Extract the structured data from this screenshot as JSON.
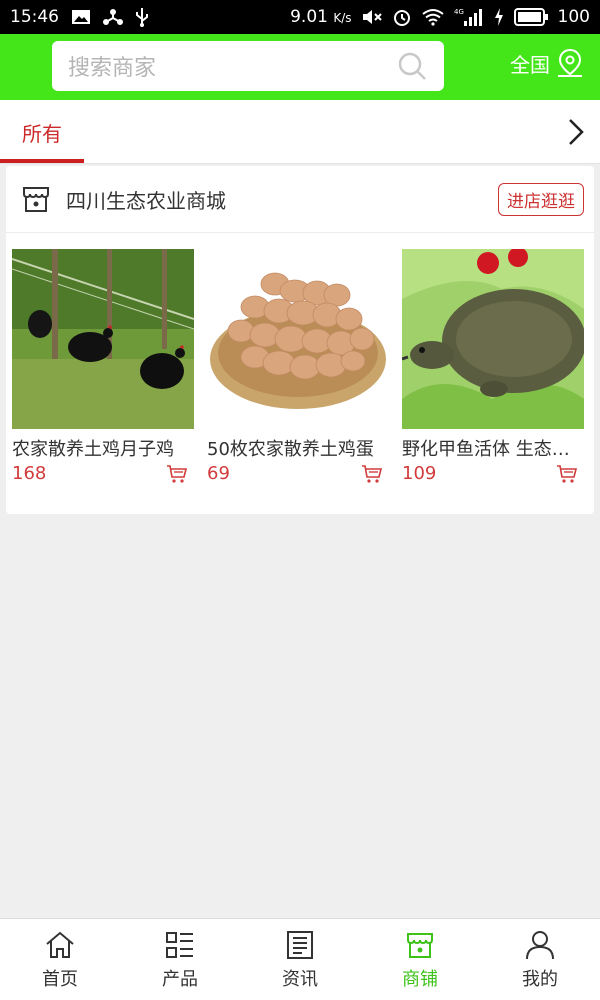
{
  "status_bar": {
    "time": "15:46",
    "speed": "9.01",
    "speed_unit": "K/s",
    "battery": "100",
    "network": "4G"
  },
  "header": {
    "search_placeholder": "搜索商家",
    "region_label": "全国",
    "bg_color": "#44e61a"
  },
  "tabs": {
    "active_label": "所有",
    "accent_color": "#cc1f1f"
  },
  "shop": {
    "name": "四川生态农业商城",
    "visit_button": "进店逛逛",
    "products": [
      {
        "title": "农家散养土鸡月子鸡",
        "price": "168"
      },
      {
        "title": "50枚农家散养土鸡蛋",
        "price": "69"
      },
      {
        "title": "野化甲鱼活体 生态甲鱼",
        "price": "109"
      }
    ]
  },
  "bottom_nav": {
    "items": [
      {
        "label": "首页",
        "icon": "home-icon"
      },
      {
        "label": "产品",
        "icon": "grid-list-icon"
      },
      {
        "label": "资讯",
        "icon": "news-icon"
      },
      {
        "label": "商铺",
        "icon": "store-icon",
        "active": true
      },
      {
        "label": "我的",
        "icon": "user-icon"
      }
    ],
    "active_color": "#3dc21a"
  }
}
